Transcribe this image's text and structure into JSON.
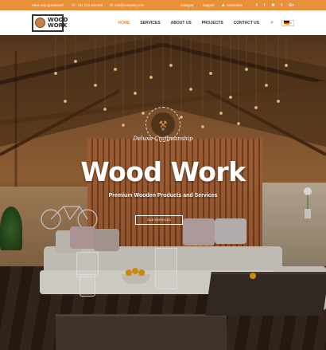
{
  "topbar": {
    "question": "Have Any Questions?",
    "phone": "+61 213 444 000",
    "email": "info@company.com",
    "category": "Category",
    "support": "Support",
    "user": "Accessites",
    "social": [
      "f",
      "t",
      "✖",
      "t",
      "G+"
    ]
  },
  "header": {
    "logo_line1": "WOOD",
    "logo_line2": "WORK",
    "nav": [
      "HOME",
      "SERVICES",
      "ABOUT US",
      "PROJECTS",
      "CONTACT US"
    ],
    "active_index": 0
  },
  "hero": {
    "badge_title": "Deluxe Craftmanship",
    "title": "Wood Work",
    "subtitle": "Premium Wooden Products and Services",
    "button": "OUR SERVICES"
  },
  "colors": {
    "accent": "#e8913a",
    "topbar": "#e8913a",
    "header": "#ffffff"
  }
}
